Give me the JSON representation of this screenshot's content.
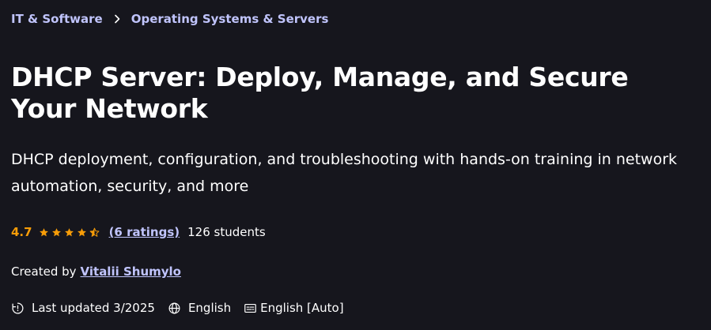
{
  "breadcrumb": {
    "items": [
      {
        "label": "IT & Software"
      },
      {
        "label": "Operating Systems & Servers"
      }
    ]
  },
  "course": {
    "title": "DHCP Server: Deploy, Manage, and Secure Your Network",
    "subtitle": "DHCP deployment, configuration, and troubleshooting with hands-on training in network automation, security, and more"
  },
  "rating": {
    "value": "4.7",
    "stars": 4.5,
    "ratings_link": "(6 ratings)",
    "students": "126 students"
  },
  "creator": {
    "prefix": "Created by",
    "name": "Vitalii Shumylo"
  },
  "meta": {
    "last_updated": "Last updated 3/2025",
    "language": "English",
    "captions": "English [Auto]"
  },
  "colors": {
    "background": "#16161d",
    "link": "#c0c4fc",
    "star": "#f69c08",
    "text": "#ffffff"
  }
}
